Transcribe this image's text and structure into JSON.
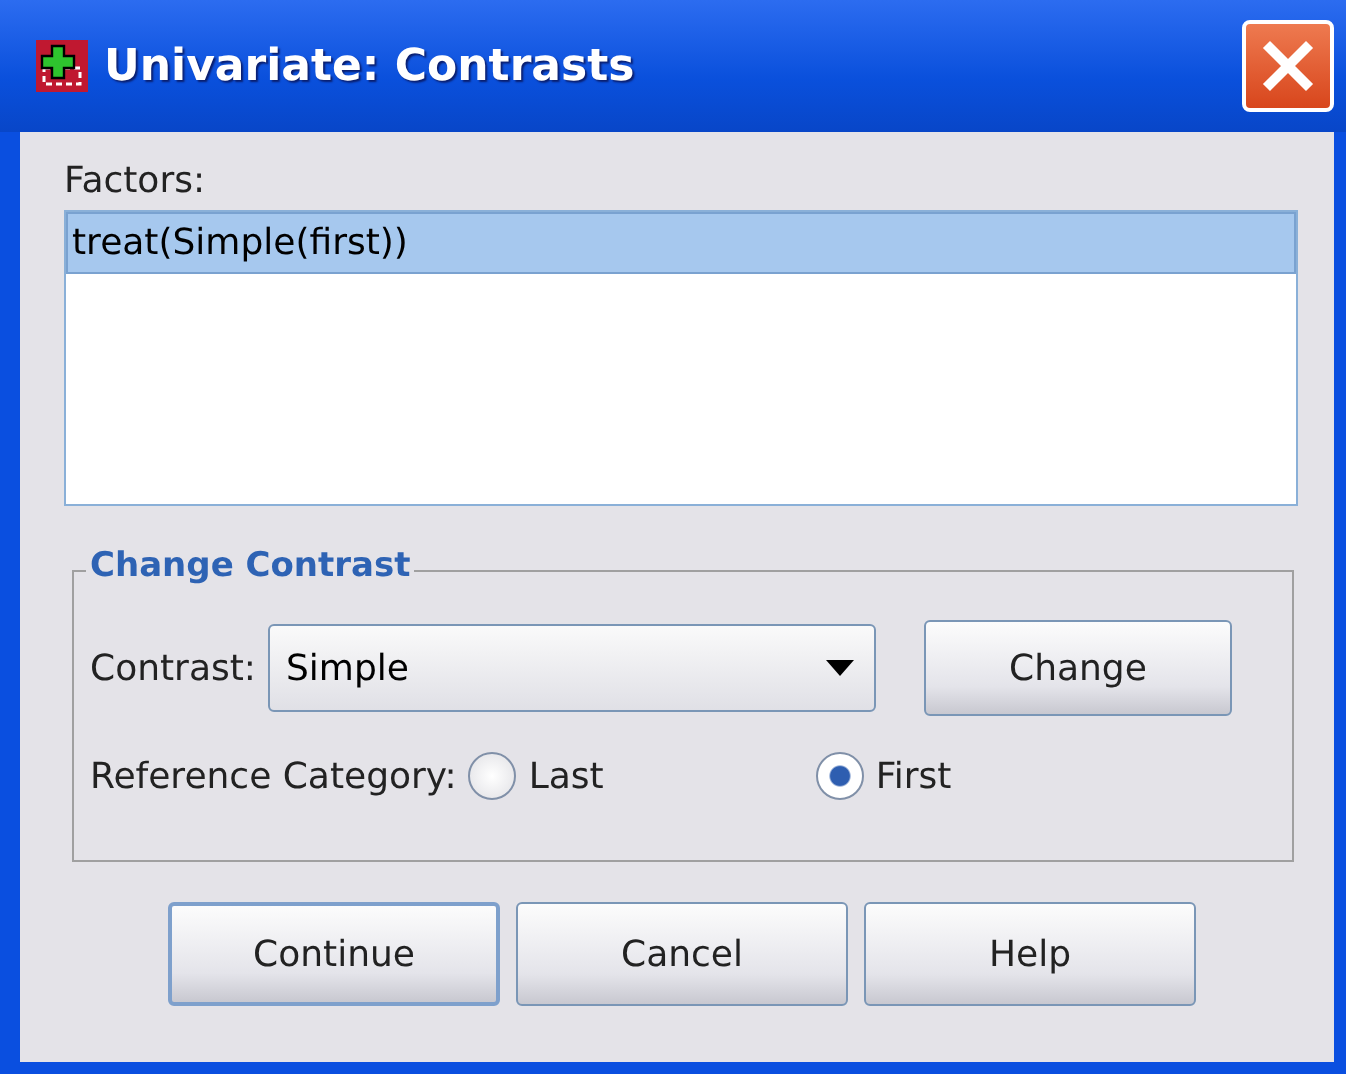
{
  "window": {
    "title": "Univariate: Contrasts"
  },
  "factors": {
    "label": "Factors:",
    "items": [
      {
        "text": "treat(Simple(first))",
        "selected": true
      }
    ]
  },
  "change_contrast": {
    "title": "Change Contrast",
    "contrast_label": "Contrast:",
    "contrast_value": "Simple",
    "change_button": "Change",
    "reference_label": "Reference Category:",
    "options": [
      {
        "label": "Last",
        "selected": false
      },
      {
        "label": "First",
        "selected": true
      }
    ]
  },
  "buttons": [
    {
      "label": "Continue",
      "default": true
    },
    {
      "label": "Cancel",
      "default": false
    },
    {
      "label": "Help",
      "default": false
    }
  ]
}
